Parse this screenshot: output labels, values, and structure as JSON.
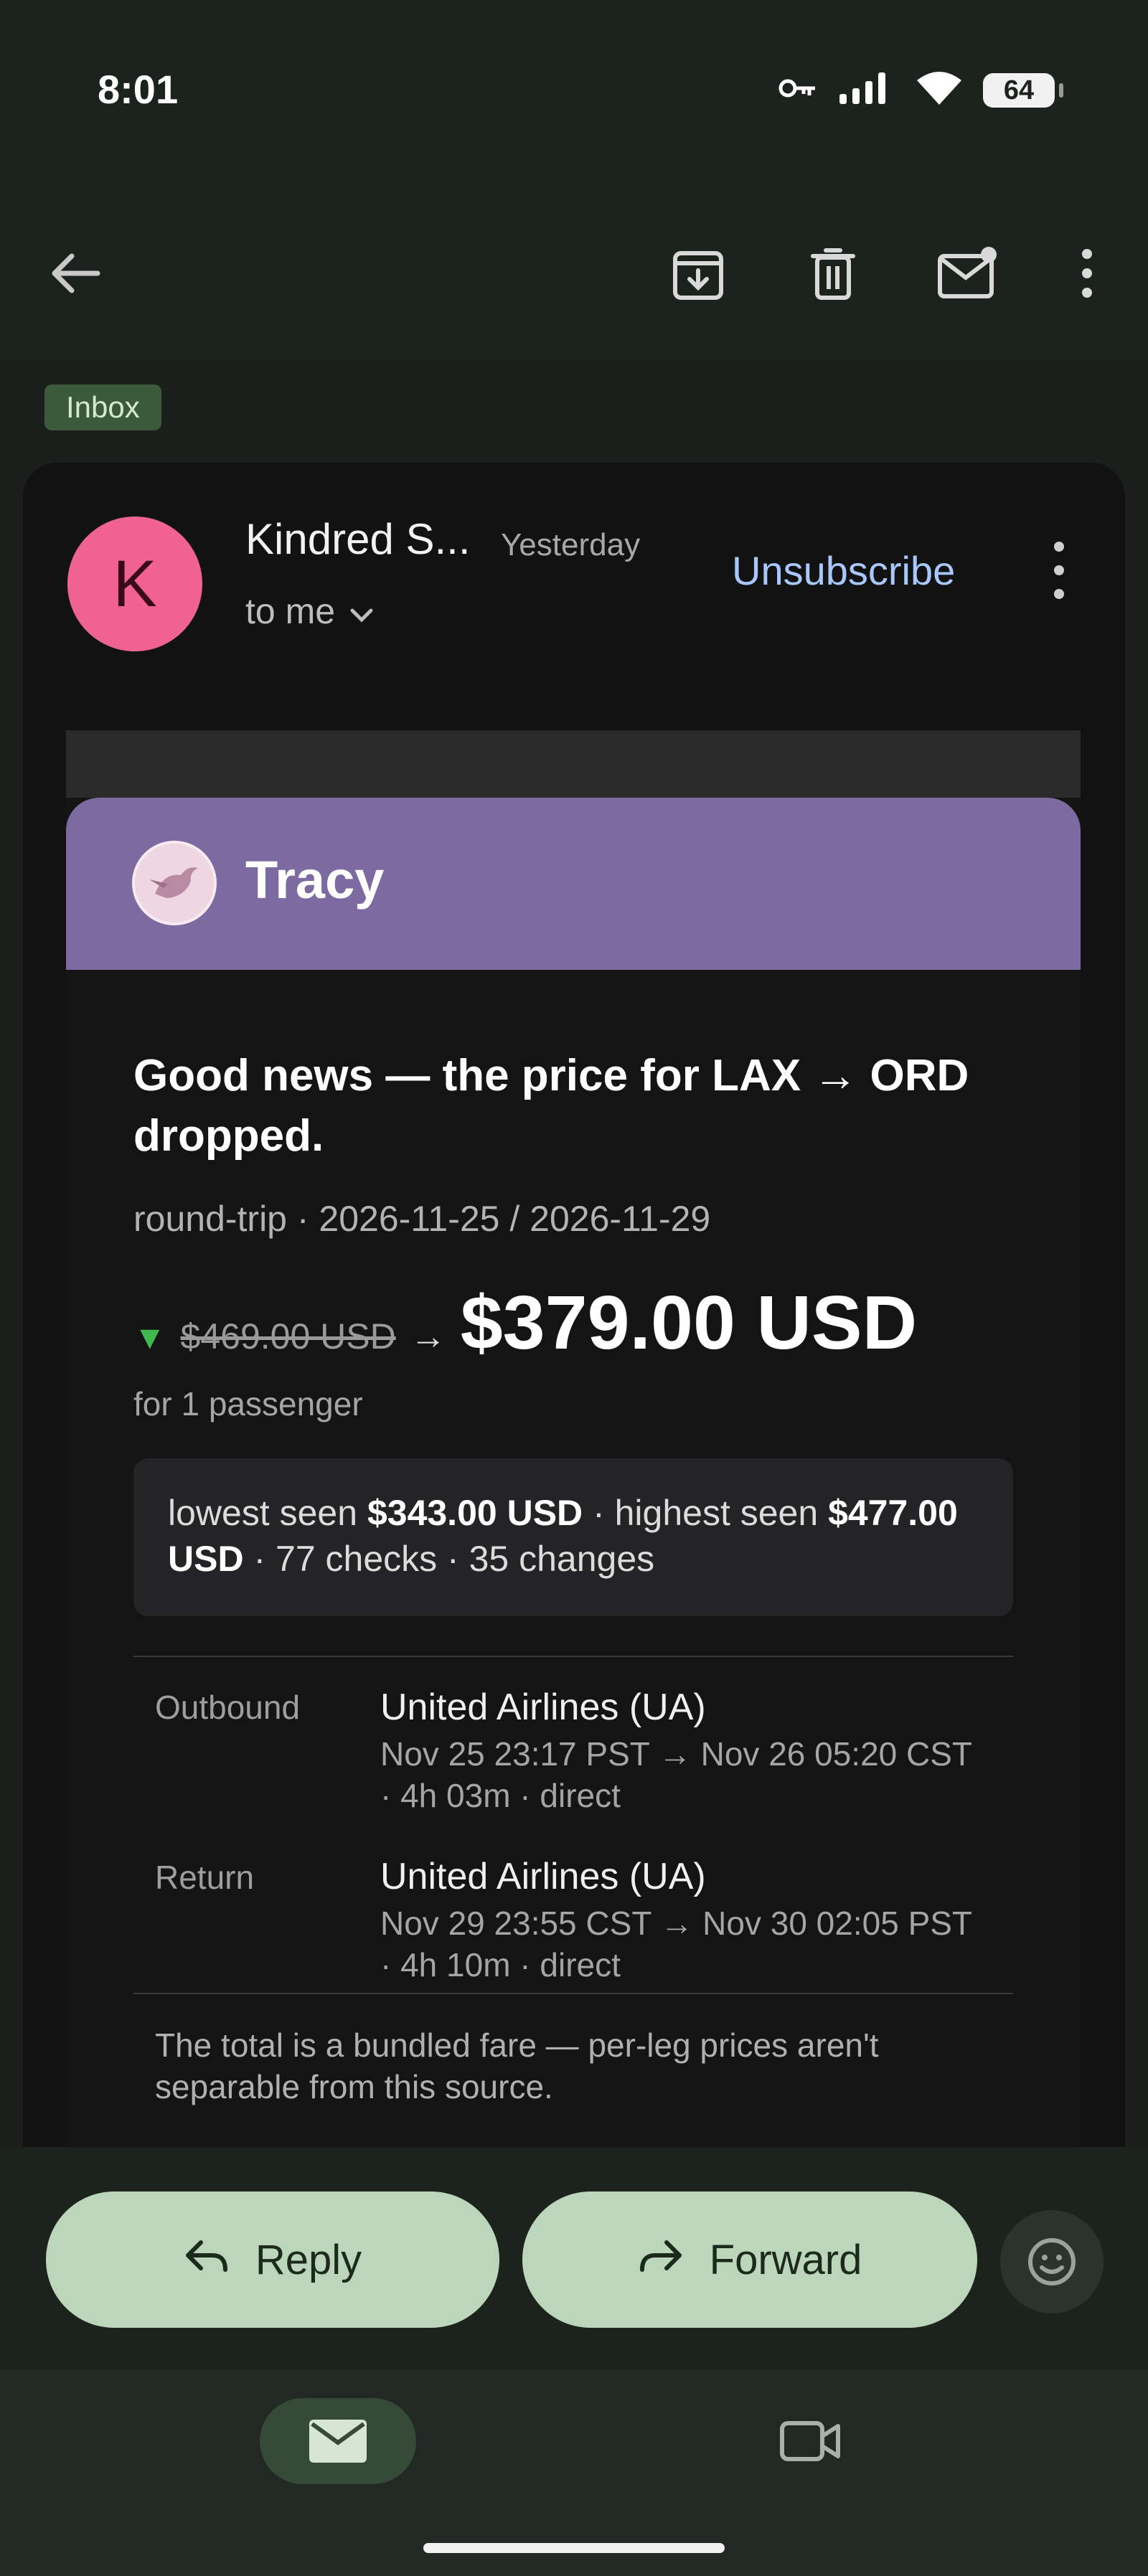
{
  "status_bar": {
    "time": "8:01",
    "battery": "64"
  },
  "toolbar": {
    "icons": [
      "back-arrow-icon",
      "archive-icon",
      "delete-icon",
      "mark-unread-icon",
      "more-vert-icon"
    ]
  },
  "label": "Inbox",
  "email": {
    "avatar_letter": "K",
    "sender": "Kindred S...",
    "date": "Yesterday",
    "recipient": "to me",
    "unsubscribe": "Unsubscribe"
  },
  "body": {
    "brand": "Tracy",
    "headline": "Good news — the price for LAX → ORD dropped.",
    "trip": "round-trip · 2026-11-25 / 2026-11-29",
    "price_down_symbol": "▼",
    "old_price": "$469.00 USD",
    "arrow": "→",
    "new_price": "$379.00 USD",
    "passengers": "for 1 passenger",
    "stats": {
      "lowest_label": "lowest seen",
      "lowest": "$343.00 USD",
      "highest_label": "· highest seen",
      "highest": "$477.00 USD",
      "rest": "· 77 checks · 35 changes"
    },
    "legs": [
      {
        "label": "Outbound",
        "airline": "United Airlines (UA)",
        "detail": "Nov 25 23:17 PST → Nov 26 05:20 CST · 4h 03m · direct"
      },
      {
        "label": "Return",
        "airline": "United Airlines (UA)",
        "detail": "Nov 29 23:55 CST → Nov 30 02:05 PST · 4h 10m · direct"
      }
    ],
    "note": "The total is a bundled fare — per-leg prices aren't separable from this source."
  },
  "actions": {
    "reply": "Reply",
    "forward": "Forward"
  },
  "colors": {
    "accent_green": "#bcd6bb",
    "link_blue": "#a8c7fa",
    "brand_purple": "#7c6aa1",
    "avatar_pink": "#f06292"
  }
}
